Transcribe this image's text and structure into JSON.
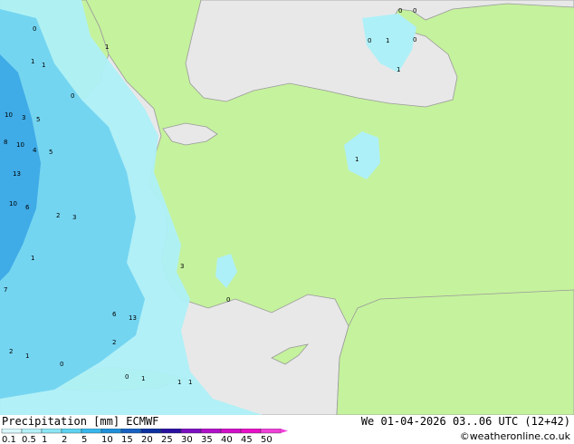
{
  "title": "Precipitation [mm]",
  "model": "ECMWF",
  "valid_time": "We 01-04-2026 03..06 UTC (12+42)",
  "credit": "©weatheronline.co.uk",
  "colors": {
    "land": "#c5f29d",
    "sea": "#e8e8e8",
    "precip_light": "#aef0f8",
    "precip_mid": "#6ed2f0",
    "precip_heavy": "#3aa6e6",
    "border": "#9a9a9a"
  },
  "legend": {
    "labels": [
      "0.1",
      "0.5",
      "1",
      "2",
      "5",
      "10",
      "15",
      "20",
      "25",
      "30",
      "35",
      "40",
      "45",
      "50"
    ],
    "colors": [
      "#d8f8fc",
      "#b4f0f8",
      "#8ce6f4",
      "#5cd2f0",
      "#38b8ec",
      "#1f8fd8",
      "#1660c0",
      "#0c30a0",
      "#2a10a0",
      "#7a10c0",
      "#b010c8",
      "#d010c8",
      "#e810c8",
      "#f040d8"
    ]
  },
  "map_values": [
    {
      "v": "0",
      "lbl": "n01"
    },
    {
      "v": "0",
      "lbl": "n02"
    },
    {
      "v": "0",
      "lbl": "n03"
    },
    {
      "v": "1",
      "lbl": "n04"
    },
    {
      "v": "0",
      "lbl": "n05"
    },
    {
      "v": "1",
      "lbl": "n06"
    },
    {
      "v": "1",
      "lbl": "n07"
    },
    {
      "v": "1",
      "lbl": "n08"
    },
    {
      "v": "0",
      "lbl": "n09"
    },
    {
      "v": "1",
      "lbl": "n10"
    },
    {
      "v": "0",
      "lbl": "n11"
    },
    {
      "v": "10",
      "lbl": "n12"
    },
    {
      "v": "3",
      "lbl": "n13"
    },
    {
      "v": "5",
      "lbl": "n14"
    },
    {
      "v": "10",
      "lbl": "n15"
    },
    {
      "v": "4",
      "lbl": "n16"
    },
    {
      "v": "5",
      "lbl": "n17"
    },
    {
      "v": "13",
      "lbl": "n18"
    },
    {
      "v": "8",
      "lbl": "n19"
    },
    {
      "v": "10",
      "lbl": "n20"
    },
    {
      "v": "6",
      "lbl": "n21"
    },
    {
      "v": "2",
      "lbl": "n22"
    },
    {
      "v": "3",
      "lbl": "n23"
    },
    {
      "v": "1",
      "lbl": "n24"
    },
    {
      "v": "7",
      "lbl": "n25"
    },
    {
      "v": "6",
      "lbl": "n26"
    },
    {
      "v": "13",
      "lbl": "n27"
    },
    {
      "v": "2",
      "lbl": "n28"
    },
    {
      "v": "2",
      "lbl": "n29"
    },
    {
      "v": "0",
      "lbl": "n30"
    },
    {
      "v": "1",
      "lbl": "n31"
    },
    {
      "v": "1",
      "lbl": "n32"
    },
    {
      "v": "0",
      "lbl": "n33"
    },
    {
      "v": "3",
      "lbl": "n34"
    },
    {
      "v": "1",
      "lbl": "n35"
    },
    {
      "v": "0",
      "lbl": "n36"
    },
    {
      "v": "1",
      "lbl": "n37"
    },
    {
      "v": "1",
      "lbl": "n38"
    }
  ]
}
